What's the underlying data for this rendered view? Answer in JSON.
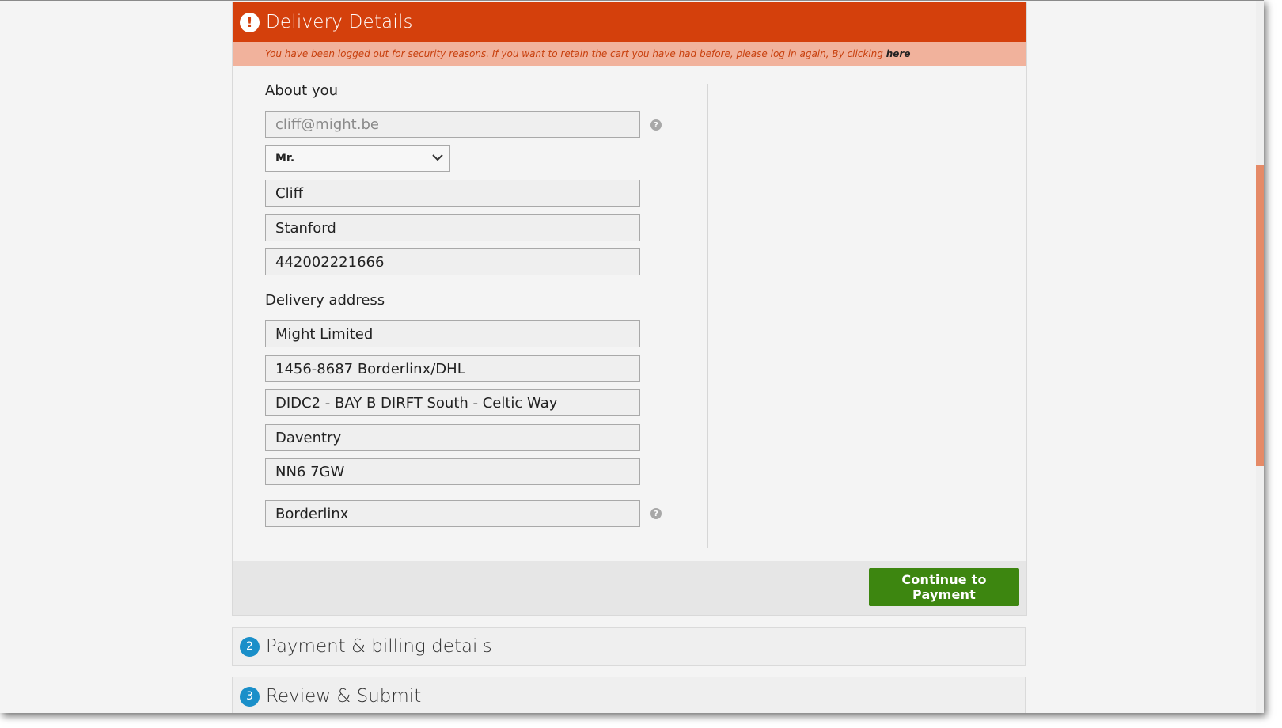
{
  "delivery": {
    "header": {
      "icon": "exclamation-icon",
      "glyph": "!",
      "title": "Delivery Details"
    },
    "notice": {
      "text": "You have been logged out for security reasons. If you want to retain the cart you have had before, please log in again, By clicking",
      "link": "here"
    },
    "about": {
      "label": "About you",
      "email": "cliff@might.be",
      "title_select": "Mr.",
      "first_name": "Cliff",
      "last_name": "Stanford",
      "phone": "442002221666"
    },
    "address": {
      "label": "Delivery address",
      "company": "Might Limited",
      "line1": "1456-8687 Borderlinx/DHL",
      "line2": "DIDC2 - BAY B DIRFT South - Celtic Way",
      "city": "Daventry",
      "postcode": "NN6 7GW",
      "carrier": "Borderlinx"
    },
    "help_glyph": "?",
    "continue_label": "Continue to Payment"
  },
  "steps": [
    {
      "number": "2",
      "title": "Payment & billing details"
    },
    {
      "number": "3",
      "title": "Review & Submit"
    }
  ],
  "colors": {
    "header_bg": "#d4400c",
    "notice_bg": "#f1b29c",
    "continue_bg": "#3d8610",
    "step_badge": "#1a8fc9"
  }
}
